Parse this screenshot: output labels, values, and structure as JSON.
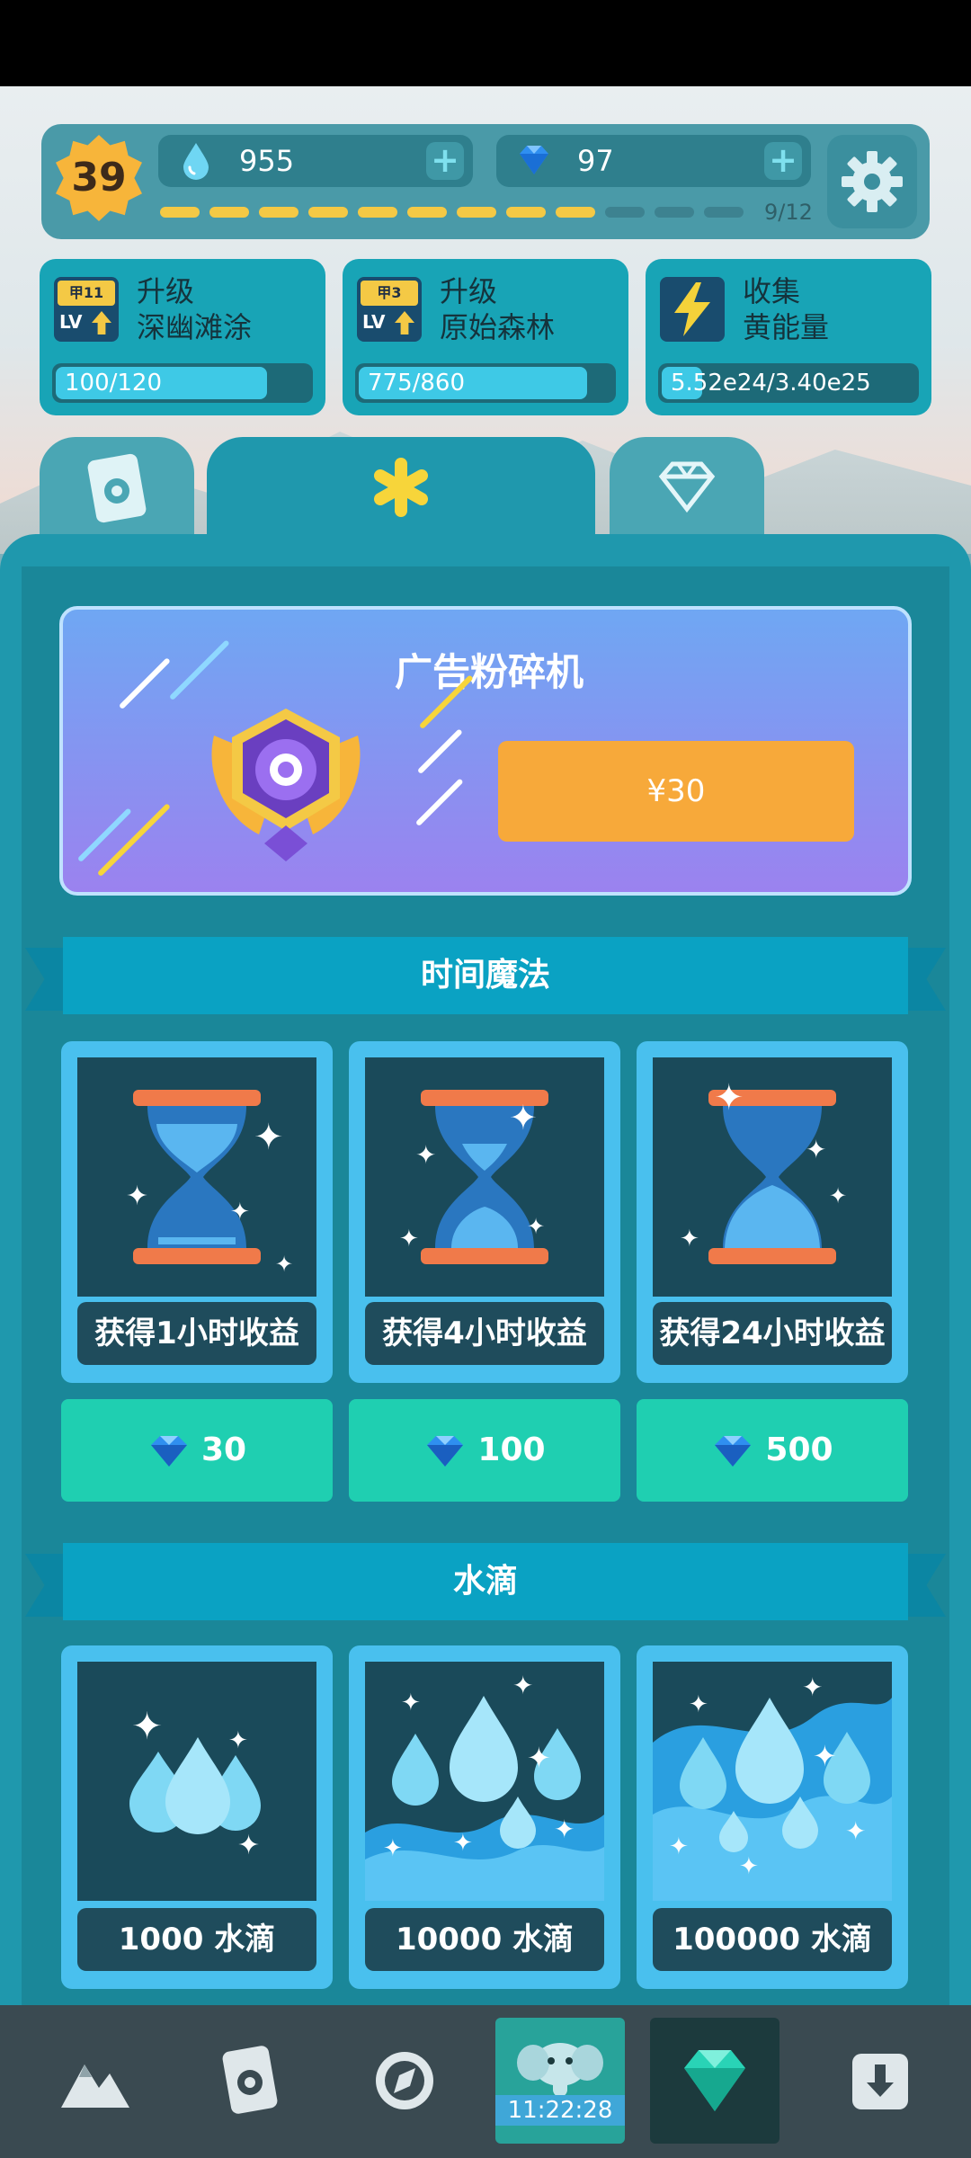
{
  "header": {
    "level": "39",
    "water": "955",
    "gems": "97",
    "plus": "+",
    "progress_text": "9/12",
    "progress_filled": 9,
    "progress_total": 12
  },
  "quests": [
    {
      "tag": "甲11",
      "lv": "LV",
      "line1": "升级",
      "line2": "深幽滩涂",
      "progress": "100/120",
      "fraction": 0.833
    },
    {
      "tag": "甲3",
      "lv": "LV",
      "line1": "升级",
      "line2": "原始森林",
      "progress": "775/860",
      "fraction": 0.9
    },
    {
      "line1": "收集",
      "line2": "黄能量",
      "progress": "5.52e24/3.40e25",
      "fraction": 0.16
    }
  ],
  "ad_crusher": {
    "title": "广告粉碎机",
    "price": "¥30"
  },
  "time_magic": {
    "title": "时间魔法",
    "items": [
      {
        "label": "获得1小时收益",
        "price": "30"
      },
      {
        "label": "获得4小时收益",
        "price": "100"
      },
      {
        "label": "获得24小时收益",
        "price": "500"
      }
    ]
  },
  "water_drops": {
    "title": "水滴",
    "items": [
      {
        "label": "1000 水滴"
      },
      {
        "label": "10000 水滴"
      },
      {
        "label": "100000 水滴"
      }
    ]
  },
  "bottom_nav": {
    "timer": "11:22:28"
  },
  "colors": {
    "accent_teal": "#1f98ad",
    "price_button": "#1fcfb1",
    "ad_price_button": "#f7a93a",
    "level_badge": "#f7b53a"
  },
  "icons": [
    "water-drop-icon",
    "gem-icon",
    "gear-icon",
    "lightning-icon",
    "card-icon",
    "asterisk-icon",
    "diamond-icon",
    "mountain-icon",
    "compass-icon",
    "elephant-icon",
    "download-icon"
  ]
}
